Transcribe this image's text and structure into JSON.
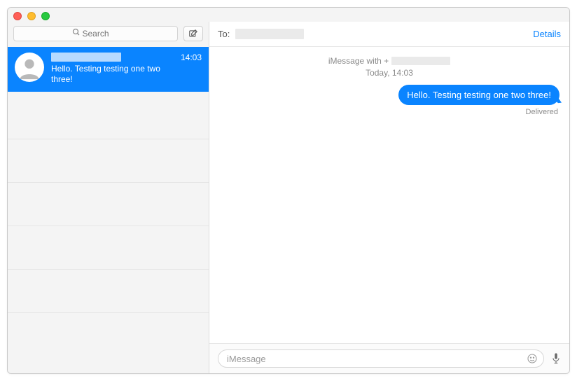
{
  "sidebar": {
    "search_placeholder": "Search",
    "conversations": [
      {
        "time": "14:03",
        "preview": "Hello. Testing testing one two three!"
      }
    ]
  },
  "header": {
    "to_label": "To:",
    "details_label": "Details"
  },
  "chat": {
    "thread_prefix": "iMessage with +",
    "timestamp": "Today, 14:03",
    "messages": [
      {
        "text": "Hello. Testing testing one two three!",
        "outgoing": true
      }
    ],
    "delivery_status": "Delivered"
  },
  "compose": {
    "placeholder": "iMessage"
  }
}
